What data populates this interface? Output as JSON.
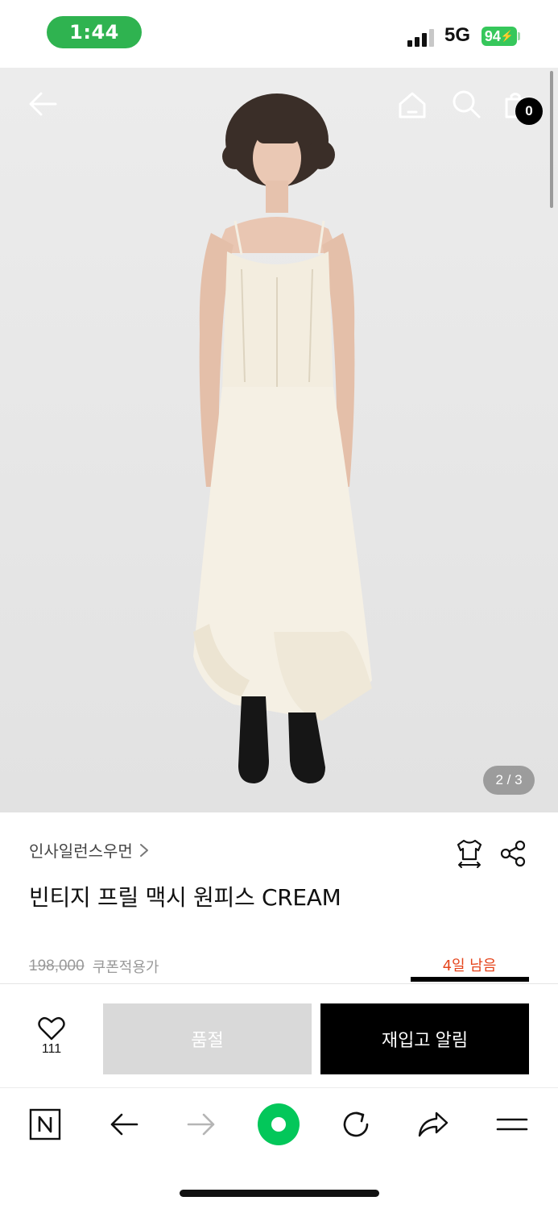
{
  "status_bar": {
    "time": "1:44",
    "network": "5G",
    "battery": "94"
  },
  "product_image": {
    "description_icon": "model-photo",
    "counter": "2 / 3"
  },
  "top_nav": {
    "cart_count": "0"
  },
  "product": {
    "brand": "인사일런스우먼",
    "title": "빈티지 프릴 맥시 원피스 CREAM",
    "original_price": "198,000",
    "coupon_label": "쿠폰적용가",
    "days_left": "4일 남음"
  },
  "actions": {
    "like_count": "111",
    "soldout_label": "품절",
    "restock_label": "재입고 알림"
  },
  "colors": {
    "accent_orange": "#e5451c",
    "status_green": "#2fb350",
    "naver_green": "#03c75a"
  }
}
